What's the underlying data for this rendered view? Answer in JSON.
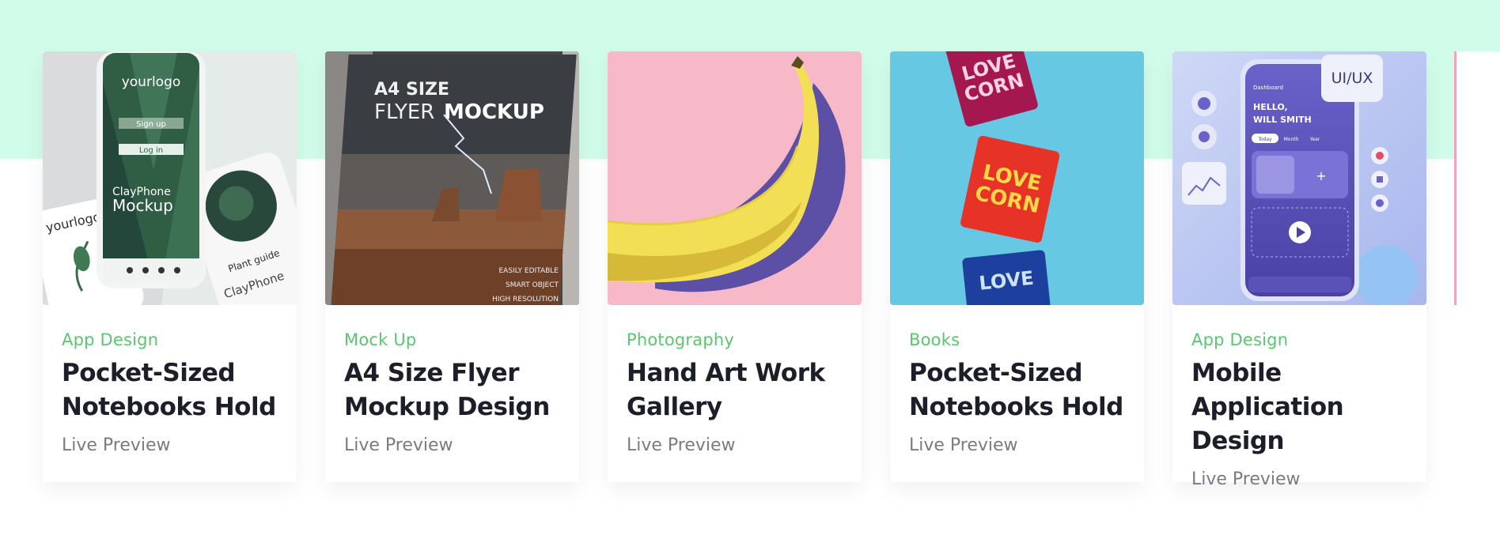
{
  "cards": [
    {
      "category": "App Design",
      "title": "Pocket-Sized Notebooks Hold",
      "link": "Live Preview",
      "image": {
        "logo_text": "yourlogo",
        "signup": "Sign up",
        "login": "Log in",
        "brand": "ClayPhone",
        "brand_sub": "Mockup",
        "guide": "Plant guide"
      }
    },
    {
      "category": "Mock Up",
      "title": "A4 Size Flyer Mockup Design",
      "link": "Live Preview",
      "image": {
        "line1": "A4 SIZE",
        "line2a": "FLYER",
        "line2b": "MOCKUP",
        "tag1": "EASILY EDITABLE",
        "tag2": "SMART OBJECT",
        "tag3": "HIGH RESOLUTION"
      }
    },
    {
      "category": "Photography",
      "title": "Hand Art Work Gallery",
      "link": "Live Preview",
      "image": {}
    },
    {
      "category": "Books",
      "title": "Pocket-Sized Notebooks Hold",
      "link": "Live Preview",
      "image": {
        "pack_text1": "LOVE",
        "pack_text2": "CORN"
      }
    },
    {
      "category": "App Design",
      "title": "Mobile Application Design",
      "link": "Live Preview",
      "image": {
        "badge": "UI/UX",
        "dashboard": "Dashboard",
        "greeting1": "HELLO,",
        "greeting2": "WILL SMITH",
        "tab1": "Today",
        "tab2": "Month",
        "tab3": "Year"
      }
    }
  ],
  "colors": {
    "mint": "#d1fce9",
    "category": "#5cc56f",
    "title": "#1c1f2a",
    "link": "#7a7a82"
  }
}
